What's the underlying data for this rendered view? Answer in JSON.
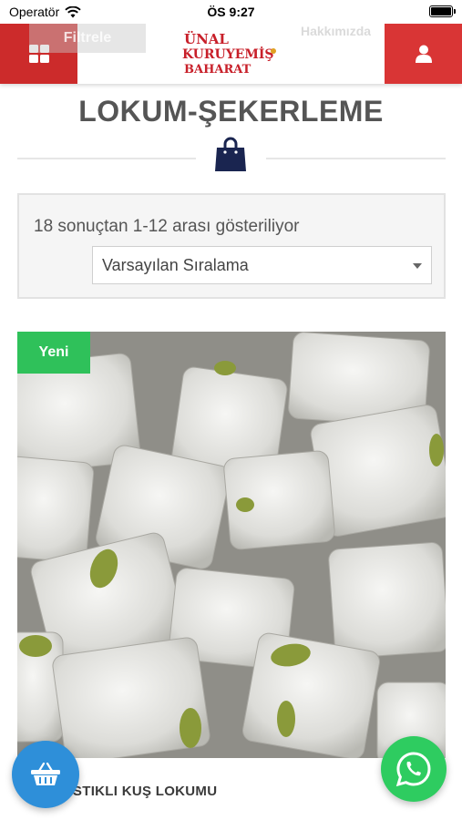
{
  "status_bar": {
    "carrier": "Operatör",
    "time": "ÖS 9:27"
  },
  "header": {
    "faded_filter_label": "Filtrele",
    "faded_link_label": "Hakkımızda",
    "logo": {
      "line1": "ÜNAL",
      "line2": "KURUYEMİŞ",
      "line3": "BAHARAT"
    },
    "icons": {
      "menu": "grid-menu-icon",
      "user": "user-icon"
    }
  },
  "page": {
    "title": "LOKUM-ŞEKERLEME",
    "title_icon": "shopping-bag-icon"
  },
  "results": {
    "count_text": "18 sonuçtan 1-12 arası gösteriliyor",
    "sort_selected": "Varsayılan Sıralama"
  },
  "product": {
    "badge": "Yeni",
    "name": "FISTIKLI KUŞ LOKUMU"
  },
  "floating": {
    "cart_icon": "basket-icon",
    "whatsapp_icon": "whatsapp-icon"
  },
  "colors": {
    "header_red": "#cc2b2b",
    "badge_green": "#2fc15a",
    "cart_blue": "#2e8fd9",
    "whatsapp_green": "#2ecc60",
    "bag_navy": "#1a2550"
  }
}
